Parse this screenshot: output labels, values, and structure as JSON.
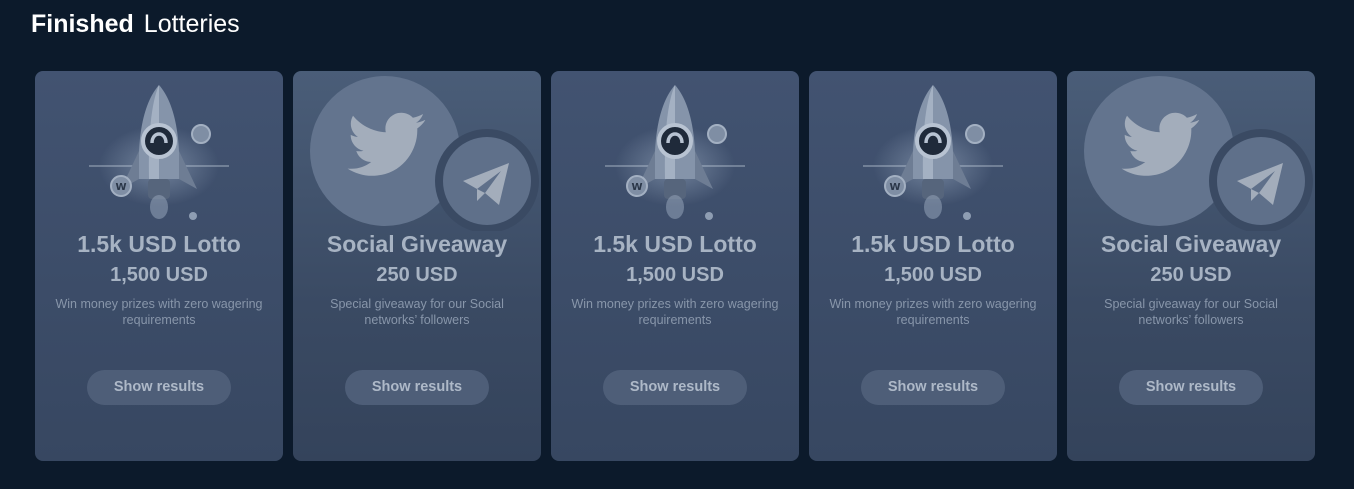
{
  "header": {
    "title_strong": "Finished",
    "title_light": "Lotteries"
  },
  "show_results_label": "Show results",
  "cards": [
    {
      "type": "lotto",
      "title": "1.5k USD Lotto",
      "amount": "1,500 USD",
      "description": "Win money prizes with zero wagering requirements",
      "icon": "rocket-icon"
    },
    {
      "type": "social",
      "title": "Social Giveaway",
      "amount": "250 USD",
      "description": "Special giveaway for our Social networks’ followers",
      "icon": "twitter-telegram-icon"
    },
    {
      "type": "lotto",
      "title": "1.5k USD Lotto",
      "amount": "1,500 USD",
      "description": "Win money prizes with zero wagering requirements",
      "icon": "rocket-icon"
    },
    {
      "type": "lotto",
      "title": "1.5k USD Lotto",
      "amount": "1,500 USD",
      "description": "Win money prizes with zero wagering requirements",
      "icon": "rocket-icon"
    },
    {
      "type": "social",
      "title": "Social Giveaway",
      "amount": "250 USD",
      "description": "Special giveaway for our Social networks’ followers",
      "icon": "twitter-telegram-icon"
    }
  ],
  "colors": {
    "background": "#0c1a2b",
    "card": "#3c4c66",
    "button": "#4e5e78",
    "text": "#a7b3c3"
  }
}
